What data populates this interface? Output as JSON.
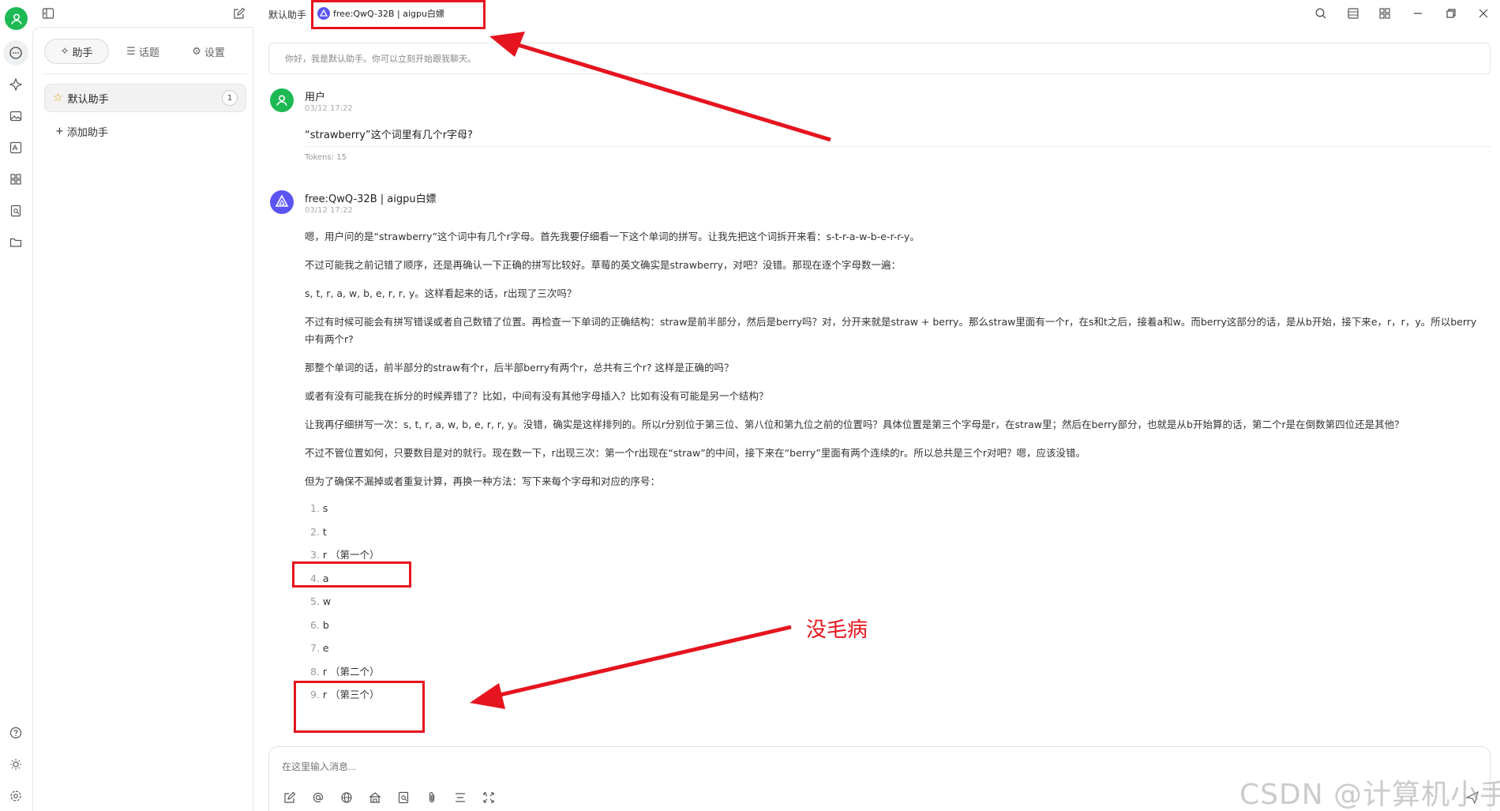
{
  "topbar": {
    "assistant_name": "默认助手",
    "model_tag": "free:QwQ-32B | aigpu白嫖"
  },
  "sidebar": {
    "tabs": [
      "助手",
      "话题",
      "设置"
    ],
    "assistant": {
      "name": "默认助手",
      "count": "1"
    },
    "add_label": "添加助手"
  },
  "welcome": "你好，我是默认助手。你可以立刻开始跟我聊天。",
  "user_message": {
    "name": "用户",
    "time": "03/12 17:22",
    "text": "“strawberry”这个词里有几个r字母?",
    "tokens": "Tokens: 15"
  },
  "ai_message": {
    "name": "free:QwQ-32B | aigpu白嫖",
    "time": "03/12 17:22",
    "paragraphs": [
      "嗯，用户问的是“strawberry”这个词中有几个r字母。首先我要仔细看一下这个单词的拼写。让我先把这个词拆开来看：s-t-r-a-w-b-e-r-r-y。",
      "不过可能我之前记错了顺序，还是再确认一下正确的拼写比较好。草莓的英文确实是strawberry，对吧？没错。那现在逐个字母数一遍：",
      "s, t, r, a, w, b, e, r, r, y。这样看起来的话，r出现了三次吗？",
      "不过有时候可能会有拼写错误或者自己数错了位置。再检查一下单词的正确结构：straw是前半部分，然后是berry吗？对，分开来就是straw + berry。那么straw里面有一个r，在s和t之后，接着a和w。而berry这部分的话，是从b开始，接下来e，r，r，y。所以berry中有两个r?",
      "那整个单词的话，前半部分的straw有个r，后半部berry有两个r，总共有三个r? 这样是正确的吗？",
      "或者有没有可能我在拆分的时候弄错了？比如，中间有没有其他字母插入？比如有没有可能是另一个结构？",
      "让我再仔细拼写一次：s, t, r, a, w, b, e, r, r, y。没错，确实是这样排列的。所以r分别位于第三位、第八位和第九位之前的位置吗？具体位置是第三个字母是r，在straw里；然后在berry部分，也就是从b开始算的话，第二个r是在倒数第四位还是其他？",
      "不过不管位置如何，只要数目是对的就行。现在数一下，r出现三次：第一个r出现在“straw”的中间，接下来在“berry”里面有两个连续的r。所以总共是三个r对吧？嗯，应该没错。",
      "但为了确保不漏掉或者重复计算，再换一种方法：写下来每个字母和对应的序号："
    ],
    "list": [
      {
        "num": "1.",
        "text": "s"
      },
      {
        "num": "2.",
        "text": "t"
      },
      {
        "num": "3.",
        "text": "r （第一个）"
      },
      {
        "num": "4.",
        "text": "a"
      },
      {
        "num": "5.",
        "text": "w"
      },
      {
        "num": "6.",
        "text": "b"
      },
      {
        "num": "7.",
        "text": "e"
      },
      {
        "num": "8.",
        "text": "r （第二个）"
      },
      {
        "num": "9.",
        "text": "r （第三个）"
      }
    ]
  },
  "input": {
    "placeholder": "在这里输入消息..."
  },
  "annotation": {
    "note": "没毛病",
    "color": "#e5141e"
  },
  "watermark": "CSDN @计算机小手"
}
